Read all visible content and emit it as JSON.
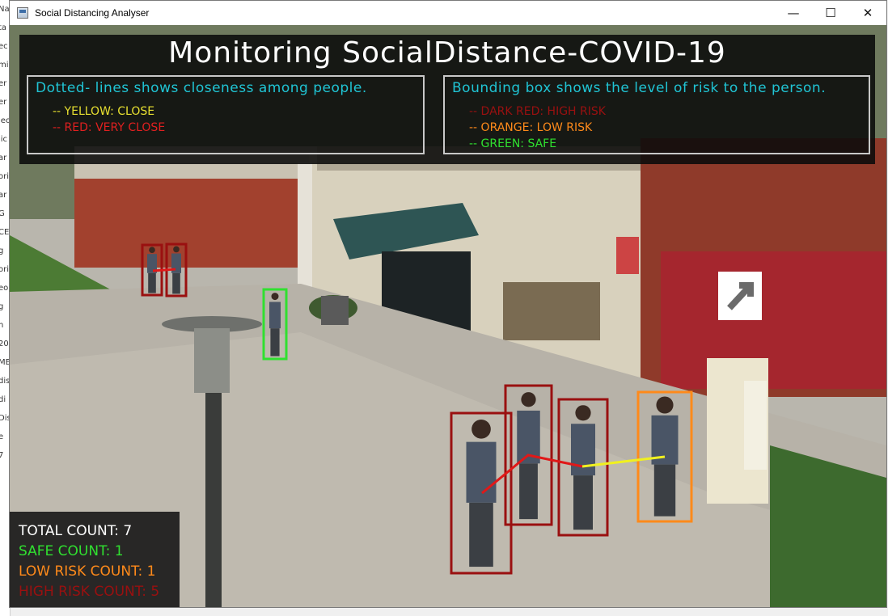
{
  "window": {
    "title": "Social Distancing Analyser",
    "minimize_glyph": "—",
    "maximize_glyph": "☐",
    "close_glyph": "✕"
  },
  "background_strip": [
    "Na",
    "ta",
    "ec",
    "mi",
    "er",
    "er",
    "jec",
    "lic",
    "ar",
    "ori",
    "ar",
    "G",
    "CE",
    "g",
    "ori",
    "eo",
    "g",
    "n",
    "20",
    "ME",
    "dis",
    "di",
    "Dis",
    "e",
    "7"
  ],
  "overlay": {
    "title": "Monitoring SocialDistance-COVID-19",
    "left_legend": {
      "heading": "Dotted- lines shows closeness among people.",
      "items": [
        {
          "text": "-- YELLOW: CLOSE",
          "color": "#e8e030"
        },
        {
          "text": "-- RED: VERY CLOSE",
          "color": "#e02020"
        }
      ]
    },
    "right_legend": {
      "heading": "Bounding box shows the level of risk to the person.",
      "items": [
        {
          "text": "-- DARK RED: HIGH RISK",
          "color": "#9a1010"
        },
        {
          "text": "-- ORANGE: LOW RISK",
          "color": "#ff8a1a"
        },
        {
          "text": "-- GREEN: SAFE",
          "color": "#30e030"
        }
      ]
    },
    "counts": {
      "total": {
        "text": "TOTAL COUNT: 7",
        "color": "#ffffff"
      },
      "safe": {
        "text": "SAFE COUNT: 1",
        "color": "#30e030"
      },
      "low_risk": {
        "text": "LOW RISK COUNT: 1",
        "color": "#ff8a1a"
      },
      "high_risk": {
        "text": "HIGH RISK COUNT: 5",
        "color": "#9a1010"
      }
    }
  },
  "colors": {
    "high_risk_box": "#9a1010",
    "low_risk_box": "#ff8a1a",
    "safe_box": "#30e030",
    "red_line": "#e01818",
    "yellow_line": "#f0f020"
  },
  "detections": [
    {
      "risk": "high"
    },
    {
      "risk": "high"
    },
    {
      "risk": "safe"
    },
    {
      "risk": "high"
    },
    {
      "risk": "high"
    },
    {
      "risk": "high"
    },
    {
      "risk": "low"
    }
  ]
}
